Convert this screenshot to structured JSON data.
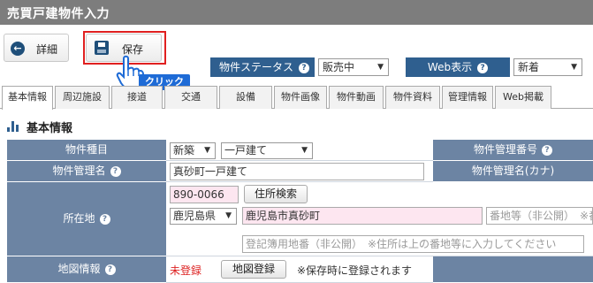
{
  "page": {
    "title": "売買戸建物件入力"
  },
  "toolbar": {
    "detail_label": "詳細",
    "save_label": "保存",
    "click_callout": "クリック",
    "status_label": "物件ステータス",
    "status_value": "販売中",
    "web_label": "Web表示",
    "web_value": "新着"
  },
  "tabs": [
    {
      "label": "基本情報"
    },
    {
      "label": "周辺施設"
    },
    {
      "label": "接道"
    },
    {
      "label": "交通"
    },
    {
      "label": "設備"
    },
    {
      "label": "物件画像"
    },
    {
      "label": "物件動画"
    },
    {
      "label": "物件資料"
    },
    {
      "label": "管理情報"
    },
    {
      "label": "Web掲載"
    }
  ],
  "section": {
    "title": "基本情報"
  },
  "form": {
    "type_label": "物件種目",
    "type_select1": "新築",
    "type_select2": "一戸建て",
    "mgmt_no_label": "物件管理番号",
    "mgmt_name_label": "物件管理名",
    "mgmt_name_value": "真砂町一戸建て",
    "mgmt_kana_label": "物件管理名(カナ)",
    "address_label": "所在地",
    "postal_value": "890-0066",
    "address_search_label": "住所検索",
    "pref_value": "鹿児島県",
    "city_value": "鹿児島市真砂町",
    "banchi_placeholder": "番地等（非公開）",
    "banchi_placeholder2": "※番",
    "registry_placeholder": "登記簿用地番（非公開）　※住所は上の番地等に入力してください",
    "map_label": "地図情報",
    "map_status": "未登録",
    "map_register_label": "地図登録",
    "map_note": "※保存時に登録されます"
  }
}
